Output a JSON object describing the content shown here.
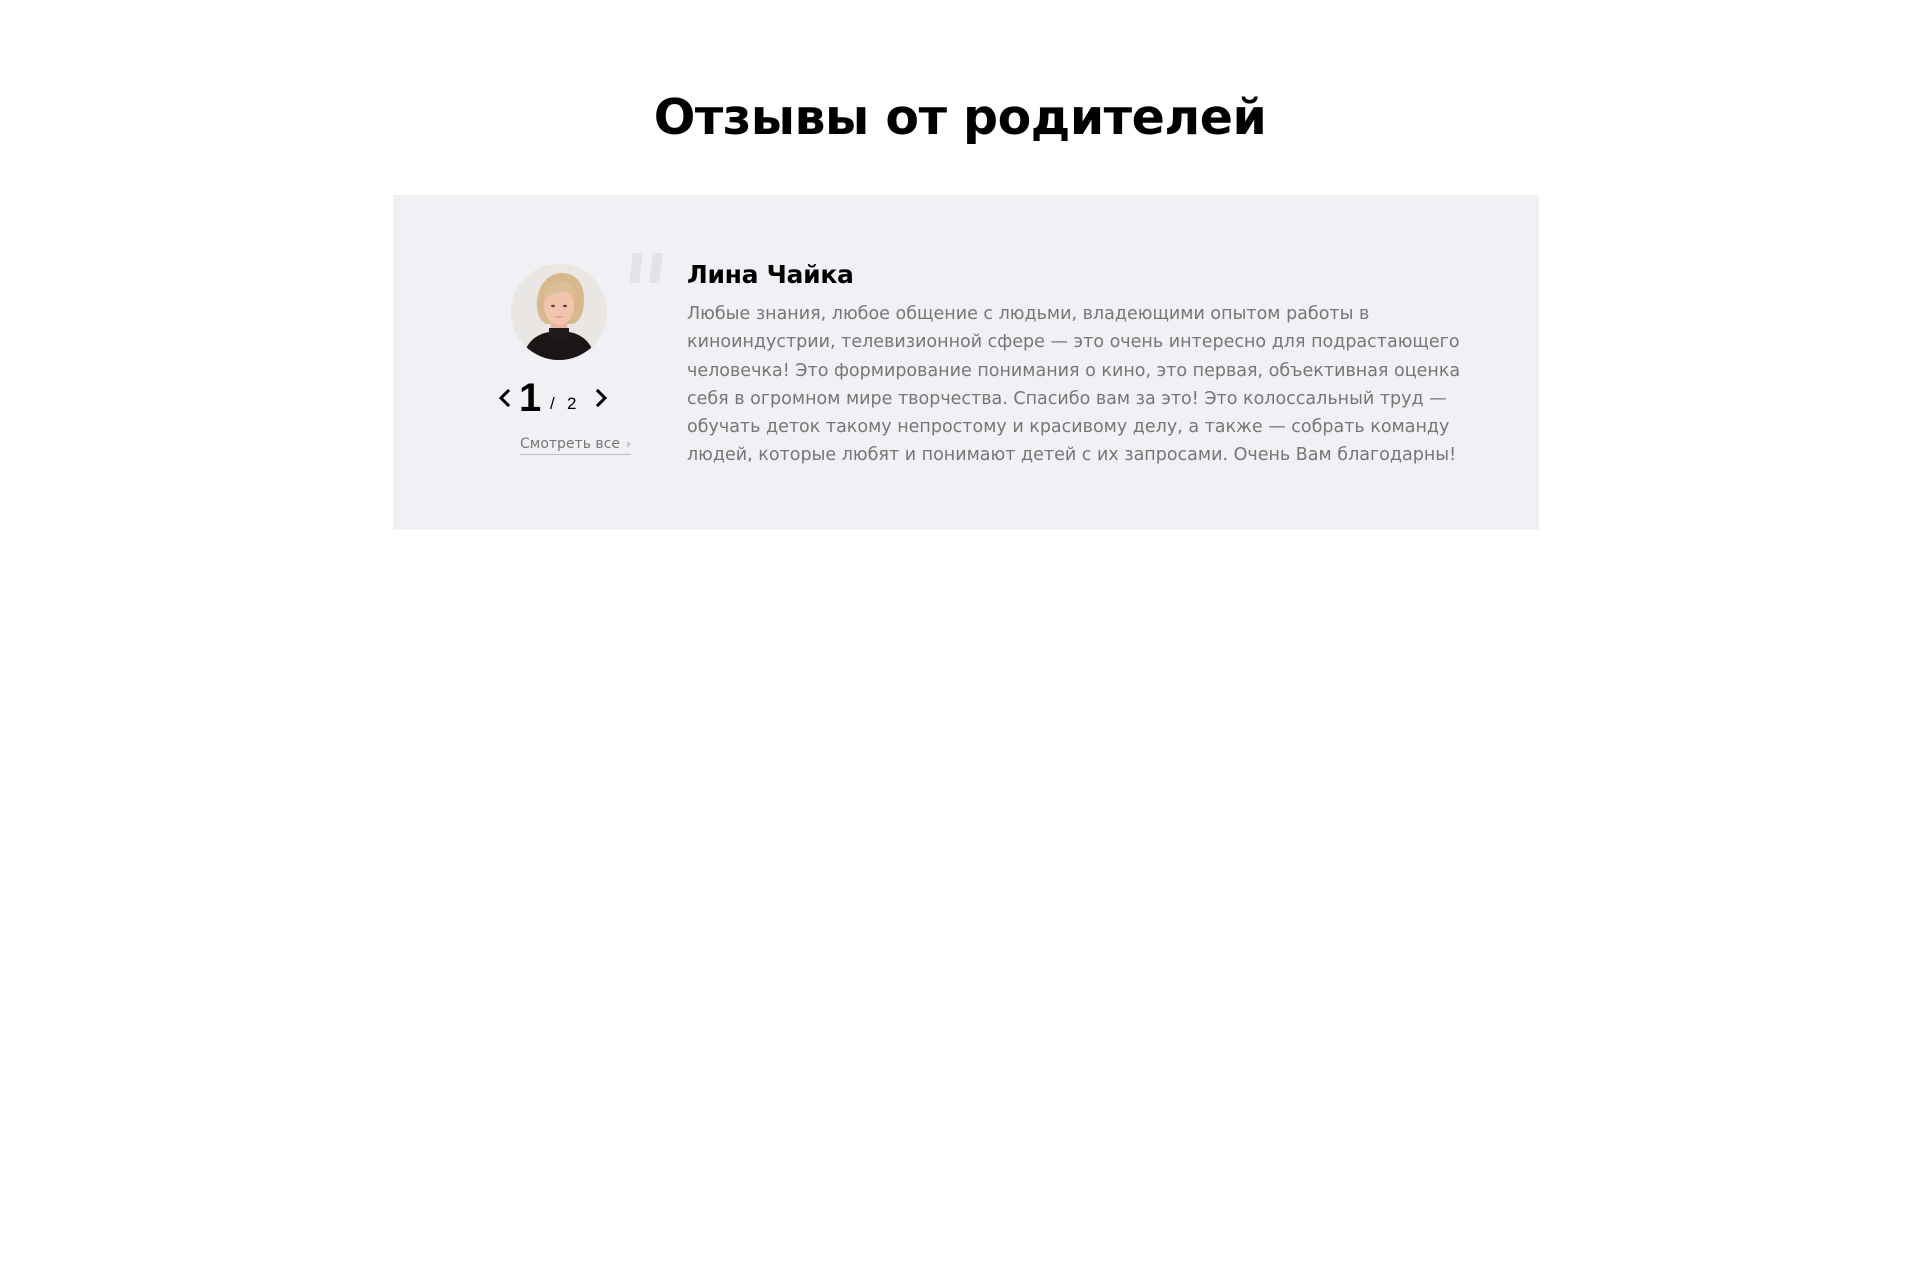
{
  "section": {
    "title": "Отзывы от родителей"
  },
  "review": {
    "author": "Лина Чайка",
    "text": "Любые знания, любое общение с людьми, владеющими опытом работы в киноиндустрии, телевизионной сфере — это очень интересно для подрастающего человечка! Это формирование понимания о кино, это первая, объективная оценка себя в огромном мире творчества. Спасибо вам за это! Это колоссальный труд — обучать деток такому непростому и красивому делу, а также — собрать команду людей, которые любят и понимают детей с их запросами. Очень Вам благодарны!"
  },
  "pager": {
    "current": "1",
    "separator": "/",
    "total": "2"
  },
  "view_all": {
    "label": "Смотреть все"
  },
  "icons": {
    "prev": "chevron-left-icon",
    "next": "chevron-right-icon",
    "quote": "quote-icon",
    "view_all_chevron": "chevron-right-icon"
  },
  "colors": {
    "card_background": "#f0f1f4",
    "body_text": "#767676",
    "heading_text": "#000000",
    "quote_mark": "#e0e1e5"
  }
}
